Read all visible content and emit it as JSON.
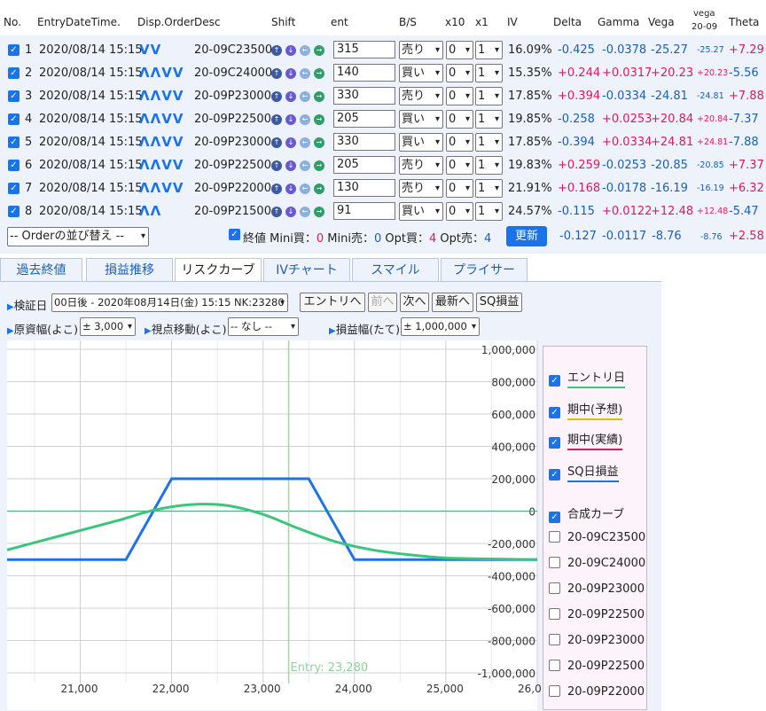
{
  "header": {
    "no": "No.",
    "entry_dt": "EntryDateTime.",
    "disp_order": "Disp.Order",
    "desc": "Desc",
    "shift": "Shift",
    "ent": "ent",
    "bs": "B/S",
    "x10": "x10",
    "x1": "x1",
    "iv": "IV",
    "delta": "Delta",
    "gamma": "Gamma",
    "vega": "Vega",
    "vega_sq": "vega",
    "vega_sq2": "20-09",
    "theta": "Theta"
  },
  "rows": [
    {
      "no": "1",
      "dt": "2020/08/14 15:15",
      "order": "⌄⌄",
      "desc": "20-09C23500",
      "ent": "315",
      "bs": "売り",
      "x10": "0",
      "x1": "1",
      "iv": "16.09%",
      "delta": "-0.425",
      "gamma": "-0.0378",
      "vega": "-25.27",
      "vega_sq": "-25.27",
      "theta": "+7.29"
    },
    {
      "no": "2",
      "dt": "2020/08/14 15:15",
      "order": "⌃⌃⌄⌄",
      "desc": "20-09C24000",
      "ent": "140",
      "bs": "買い",
      "x10": "0",
      "x1": "1",
      "iv": "15.35%",
      "delta": "+0.244",
      "gamma": "+0.0317",
      "vega": "+20.23",
      "vega_sq": "+20.23",
      "theta": "-5.56"
    },
    {
      "no": "3",
      "dt": "2020/08/14 15:15",
      "order": "⌃⌃⌄⌄",
      "desc": "20-09P23000",
      "ent": "330",
      "bs": "売り",
      "x10": "0",
      "x1": "1",
      "iv": "17.85%",
      "delta": "+0.394",
      "gamma": "-0.0334",
      "vega": "-24.81",
      "vega_sq": "-24.81",
      "theta": "+7.88"
    },
    {
      "no": "4",
      "dt": "2020/08/14 15:15",
      "order": "⌃⌃⌄⌄",
      "desc": "20-09P22500",
      "ent": "205",
      "bs": "買い",
      "x10": "0",
      "x1": "1",
      "iv": "19.85%",
      "delta": "-0.258",
      "gamma": "+0.0253",
      "vega": "+20.84",
      "vega_sq": "+20.84",
      "theta": "-7.37"
    },
    {
      "no": "5",
      "dt": "2020/08/14 15:15",
      "order": "⌃⌃⌄⌄",
      "desc": "20-09P23000",
      "ent": "330",
      "bs": "買い",
      "x10": "0",
      "x1": "1",
      "iv": "17.85%",
      "delta": "-0.394",
      "gamma": "+0.0334",
      "vega": "+24.81",
      "vega_sq": "+24.81",
      "theta": "-7.88"
    },
    {
      "no": "6",
      "dt": "2020/08/14 15:15",
      "order": "⌃⌃⌄⌄",
      "desc": "20-09P22500",
      "ent": "205",
      "bs": "売り",
      "x10": "0",
      "x1": "1",
      "iv": "19.83%",
      "delta": "+0.259",
      "gamma": "-0.0253",
      "vega": "-20.85",
      "vega_sq": "-20.85",
      "theta": "+7.37"
    },
    {
      "no": "7",
      "dt": "2020/08/14 15:15",
      "order": "⌃⌃⌄⌄",
      "desc": "20-09P22000",
      "ent": "130",
      "bs": "売り",
      "x10": "0",
      "x1": "1",
      "iv": "21.91%",
      "delta": "+0.168",
      "gamma": "-0.0178",
      "vega": "-16.19",
      "vega_sq": "-16.19",
      "theta": "+6.32"
    },
    {
      "no": "8",
      "dt": "2020/08/14 15:15",
      "order": "⌃⌃",
      "desc": "20-09P21500",
      "ent": "91",
      "bs": "買い",
      "x10": "0",
      "x1": "1",
      "iv": "24.57%",
      "delta": "-0.115",
      "gamma": "+0.0122",
      "vega": "+12.48",
      "vega_sq": "+12.48",
      "theta": "-5.47"
    }
  ],
  "footer": {
    "sort_select": "-- Orderの並び替え --",
    "close_label": "終値",
    "mini_buy_label": "Mini買：",
    "mini_buy": "0",
    "mini_sell_label": "Mini売：",
    "mini_sell": "0",
    "opt_buy_label": "Opt買：",
    "opt_buy": "4",
    "opt_sell_label": "Opt売：",
    "opt_sell": "4",
    "update_button": "更新",
    "delta": "-0.127",
    "gamma": "-0.0117",
    "vega": "-8.76",
    "vega_sq": "-8.76",
    "theta": "+2.58"
  },
  "tabs": [
    "過去終値",
    "損益推移",
    "リスクカーブ",
    "IVチャート",
    "スマイル",
    "プライサー"
  ],
  "controls": {
    "verify_label": "検証日",
    "verify_value": "00日後 - 2020年08月14日(金) 15:15 NK:23280",
    "entry_button": "エントリへ",
    "prev_button": "前へ",
    "next_button": "次へ",
    "latest_button": "最新へ",
    "sq_button": "SQ損益",
    "x_range_label": "原資幅(よこ)",
    "x_range_value": "± 3,000",
    "viewpoint_label": "視点移動(よこ)",
    "viewpoint_value": "-- なし --",
    "y_range_label": "損益幅(たて)",
    "y_range_value": "± 1,000,000"
  },
  "chart_data": {
    "type": "line",
    "xlim": [
      20200,
      26000
    ],
    "ylim": [
      -1000000,
      1000000
    ],
    "x_ticks": [
      "21,000",
      "22,000",
      "23,000",
      "24,000",
      "25,000",
      "26,0"
    ],
    "y_ticks": [
      "1,000,000",
      "800,000",
      "600,000",
      "400,000",
      "200,000",
      "0",
      "-200,000",
      "-400,000",
      "-600,000",
      "-800,000",
      "-1,000,000"
    ],
    "entry_label": "Entry: 23,280",
    "entry_x": 23280,
    "series": [
      {
        "name": "SQ日損益",
        "color": "#1a73e8",
        "x": [
          20200,
          21500,
          22000,
          23000,
          23500,
          24000,
          26000
        ],
        "y": [
          -300000,
          -300000,
          200000,
          200000,
          200000,
          -300000,
          -300000
        ]
      },
      {
        "name": "合成カーブ",
        "color": "#3cc47c",
        "x": [
          20200,
          20800,
          21400,
          21800,
          22200,
          22600,
          23000,
          23400,
          23800,
          24200,
          24600,
          25000,
          25400,
          26000
        ],
        "y": [
          -240000,
          -150000,
          -60000,
          5000,
          40000,
          35000,
          -20000,
          -110000,
          -190000,
          -240000,
          -270000,
          -290000,
          -295000,
          -300000
        ]
      }
    ]
  },
  "legend": {
    "items": [
      {
        "label": "エントリ日",
        "checked": true,
        "underline": "#3cc47c"
      },
      {
        "label": "期中(予想)",
        "checked": true,
        "underline": "#d4c400"
      },
      {
        "label": "期中(実績)",
        "checked": true,
        "underline": "#d81b60"
      },
      {
        "label": "SQ日損益",
        "checked": true,
        "underline": "#1a73e8"
      },
      {
        "label": "合成カーブ",
        "checked": true,
        "underline": ""
      },
      {
        "label": "20-09C23500",
        "checked": false,
        "underline": ""
      },
      {
        "label": "20-09C24000",
        "checked": false,
        "underline": ""
      },
      {
        "label": "20-09P23000",
        "checked": false,
        "underline": ""
      },
      {
        "label": "20-09P22500",
        "checked": false,
        "underline": ""
      },
      {
        "label": "20-09P23000",
        "checked": false,
        "underline": ""
      },
      {
        "label": "20-09P22500",
        "checked": false,
        "underline": ""
      },
      {
        "label": "20-09P22000",
        "checked": false,
        "underline": ""
      }
    ]
  }
}
